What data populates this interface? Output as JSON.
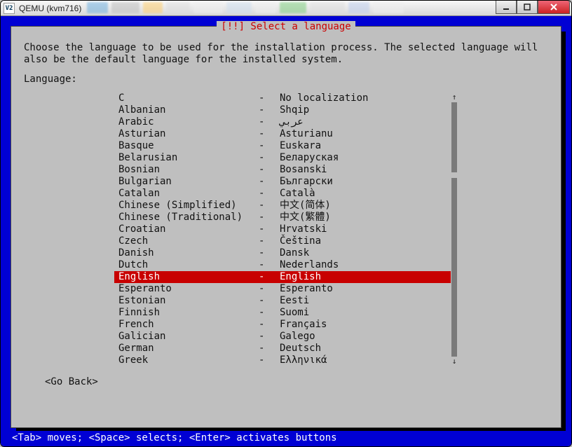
{
  "window": {
    "title": "QEMU (kvm716)"
  },
  "dialog": {
    "title": "[!!] Select a language",
    "instructions": "Choose the language to be used for the installation process. The selected language will\nalso be the default language for the installed system.",
    "list_label": "Language:",
    "go_back": "<Go Back>"
  },
  "languages": [
    {
      "name": "C",
      "native": "No localization",
      "selected": false
    },
    {
      "name": "Albanian",
      "native": "Shqip",
      "selected": false
    },
    {
      "name": "Arabic",
      "native": "عربي",
      "selected": false
    },
    {
      "name": "Asturian",
      "native": "Asturianu",
      "selected": false
    },
    {
      "name": "Basque",
      "native": "Euskara",
      "selected": false
    },
    {
      "name": "Belarusian",
      "native": "Беларуская",
      "selected": false
    },
    {
      "name": "Bosnian",
      "native": "Bosanski",
      "selected": false
    },
    {
      "name": "Bulgarian",
      "native": "Български",
      "selected": false
    },
    {
      "name": "Catalan",
      "native": "Català",
      "selected": false
    },
    {
      "name": "Chinese (Simplified)",
      "native": "中文(简体)",
      "selected": false
    },
    {
      "name": "Chinese (Traditional)",
      "native": "中文(繁體)",
      "selected": false
    },
    {
      "name": "Croatian",
      "native": "Hrvatski",
      "selected": false
    },
    {
      "name": "Czech",
      "native": "Čeština",
      "selected": false
    },
    {
      "name": "Danish",
      "native": "Dansk",
      "selected": false
    },
    {
      "name": "Dutch",
      "native": "Nederlands",
      "selected": false
    },
    {
      "name": "English",
      "native": "English",
      "selected": true
    },
    {
      "name": "Esperanto",
      "native": "Esperanto",
      "selected": false
    },
    {
      "name": "Estonian",
      "native": "Eesti",
      "selected": false
    },
    {
      "name": "Finnish",
      "native": "Suomi",
      "selected": false
    },
    {
      "name": "French",
      "native": "Français",
      "selected": false
    },
    {
      "name": "Galician",
      "native": "Galego",
      "selected": false
    },
    {
      "name": "German",
      "native": "Deutsch",
      "selected": false
    },
    {
      "name": "Greek",
      "native": "Ελληνικά",
      "selected": false
    }
  ],
  "footer": "<Tab> moves; <Space> selects; <Enter> activates buttons"
}
